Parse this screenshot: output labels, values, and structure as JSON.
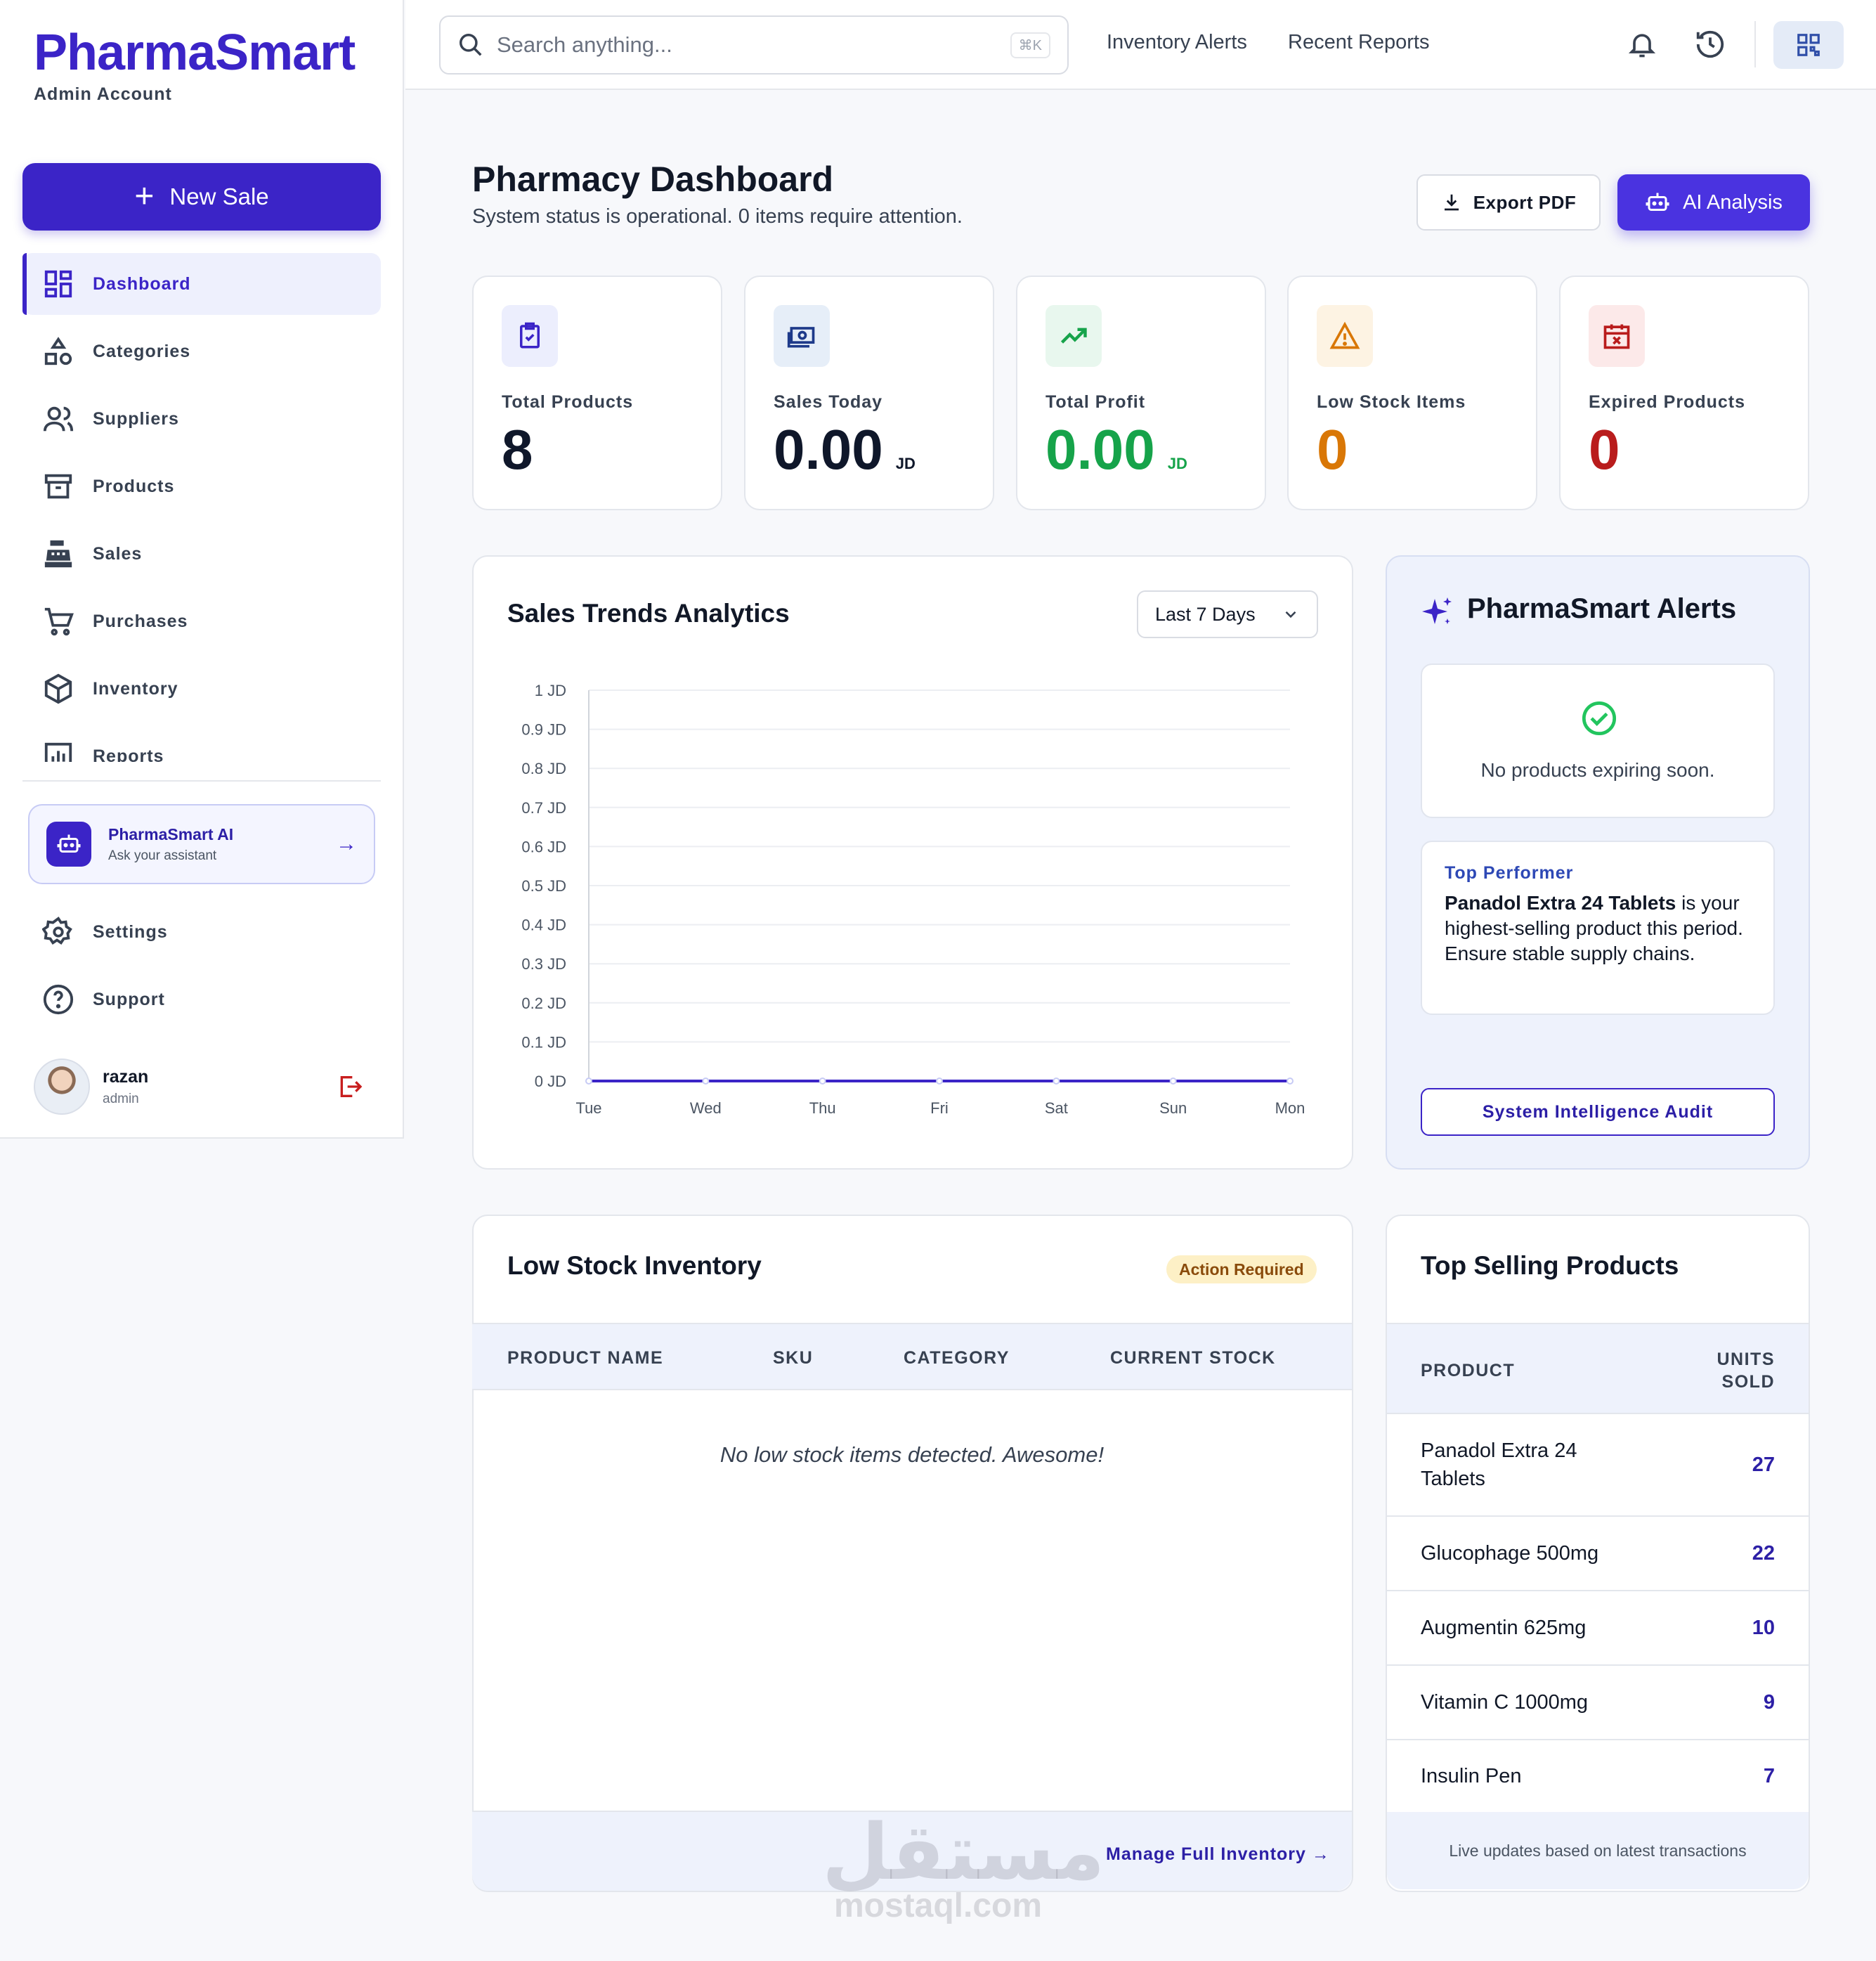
{
  "sidebar": {
    "brand": "PharmaSmart",
    "account": "Admin Account",
    "new_sale": "New Sale",
    "items": [
      {
        "label": "Dashboard",
        "icon": "dashboard-icon",
        "active": true
      },
      {
        "label": "Categories",
        "icon": "shapes-icon"
      },
      {
        "label": "Suppliers",
        "icon": "users-icon"
      },
      {
        "label": "Products",
        "icon": "archive-icon"
      },
      {
        "label": "Sales",
        "icon": "cash-register-icon"
      },
      {
        "label": "Purchases",
        "icon": "cart-icon"
      },
      {
        "label": "Inventory",
        "icon": "box-icon"
      },
      {
        "label": "Reports",
        "icon": "chart-icon"
      }
    ],
    "ai": {
      "title": "PharmaSmart AI",
      "subtitle": "Ask your assistant"
    },
    "bottom_items": [
      {
        "label": "Settings",
        "icon": "gear-icon"
      },
      {
        "label": "Support",
        "icon": "help-icon"
      }
    ],
    "user": {
      "name": "razan",
      "role": "admin"
    }
  },
  "topbar": {
    "search_placeholder": "Search anything...",
    "shortcut": "⌘K",
    "links": [
      "Inventory Alerts",
      "Recent Reports"
    ]
  },
  "header": {
    "title": "Pharmacy Dashboard",
    "subtitle": "System status is operational. 0 items require attention.",
    "export_label": "Export PDF",
    "ai_label": "AI Analysis"
  },
  "stats": [
    {
      "label": "Total Products",
      "value": "8",
      "unit": "",
      "color": "#0f172a",
      "icon_bg": "#eceefd",
      "icon": "clipboard-check-icon"
    },
    {
      "label": "Sales Today",
      "value": "0.00",
      "unit": "JD",
      "color": "#0f172a",
      "icon_bg": "#e6eef8",
      "icon": "money-icon"
    },
    {
      "label": "Total Profit",
      "value": "0.00",
      "unit": "JD",
      "color": "#16a34a",
      "icon_bg": "#e8f7ee",
      "icon": "trending-up-icon"
    },
    {
      "label": "Low Stock Items",
      "value": "0",
      "unit": "",
      "color": "#d97706",
      "icon_bg": "#fdf3e3",
      "icon": "warning-icon"
    },
    {
      "label": "Expired Products",
      "value": "0",
      "unit": "",
      "color": "#b91c1c",
      "icon_bg": "#fce9e9",
      "icon": "calendar-x-icon"
    }
  ],
  "sales_panel": {
    "title": "Sales Trends Analytics",
    "range": "Last 7 Days"
  },
  "chart_data": {
    "type": "line",
    "categories": [
      "Tue",
      "Wed",
      "Thu",
      "Fri",
      "Sat",
      "Sun",
      "Mon"
    ],
    "series": [
      {
        "values": [
          0,
          0,
          0,
          0,
          0,
          0,
          0
        ],
        "color": "#3b24c7"
      }
    ],
    "yticks": [
      "0 JD",
      "0.1 JD",
      "0.2 JD",
      "0.3 JD",
      "0.4 JD",
      "0.5 JD",
      "0.6 JD",
      "0.7 JD",
      "0.8 JD",
      "0.9 JD",
      "1 JD"
    ],
    "ylim": [
      0,
      1
    ],
    "grid": true
  },
  "alerts": {
    "title": "PharmaSmart Alerts",
    "empty_message": "No products expiring soon.",
    "top_performer_tag": "Top Performer",
    "top_performer_product": "Panadol Extra 24 Tablets",
    "top_performer_text": " is your highest-selling product this period. Ensure stable supply chains.",
    "audit_button": "System Intelligence Audit"
  },
  "low_stock": {
    "title": "Low Stock Inventory",
    "badge": "Action Required",
    "columns": [
      "PRODUCT NAME",
      "SKU",
      "CATEGORY",
      "CURRENT STOCK"
    ],
    "empty": "No low stock items detected. Awesome!",
    "footer_link": "Manage Full Inventory"
  },
  "top_selling": {
    "title": "Top Selling Products",
    "col_product": "PRODUCT",
    "col_units": "UNITS SOLD",
    "rows": [
      {
        "name": "Panadol Extra 24 Tablets",
        "units": "27"
      },
      {
        "name": "Glucophage 500mg",
        "units": "22"
      },
      {
        "name": "Augmentin 625mg",
        "units": "10"
      },
      {
        "name": "Vitamin C 1000mg",
        "units": "9"
      },
      {
        "name": "Insulin Pen",
        "units": "7"
      }
    ],
    "footer": "Live updates based on latest transactions"
  },
  "watermark": {
    "arabic": "مستقل",
    "latin": "mostaql.com"
  }
}
